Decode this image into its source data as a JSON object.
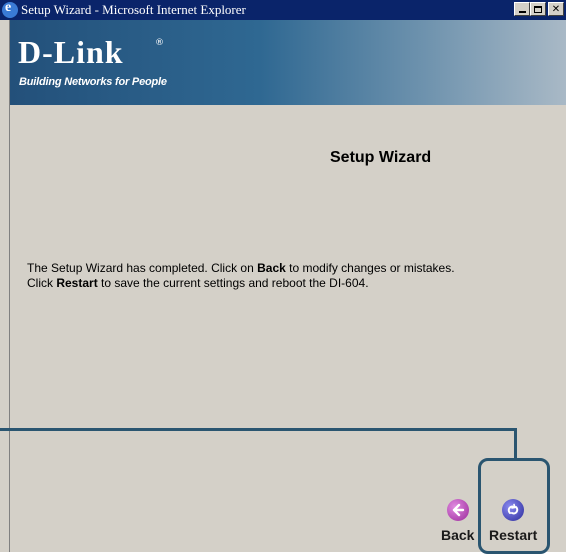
{
  "window": {
    "title": "Setup Wizard - Microsoft Internet Explorer"
  },
  "banner": {
    "logo_text": "D-Link",
    "registered_mark": "®",
    "tagline": "Building Networks for People"
  },
  "page": {
    "title": "Setup Wizard",
    "message_line1_prefix": "The Setup Wizard has completed. Click on ",
    "message_line1_bold": "Back",
    "message_line1_suffix": " to modify changes or mistakes.",
    "message_line2_prefix": "Click ",
    "message_line2_bold": "Restart",
    "message_line2_suffix": " to save the current settings and reboot the DI-604."
  },
  "nav": {
    "back_label": "Back",
    "restart_label": "Restart"
  },
  "colors": {
    "titlebar": "#0a246a",
    "callout": "#2a5570",
    "background": "#d4d0c8"
  }
}
